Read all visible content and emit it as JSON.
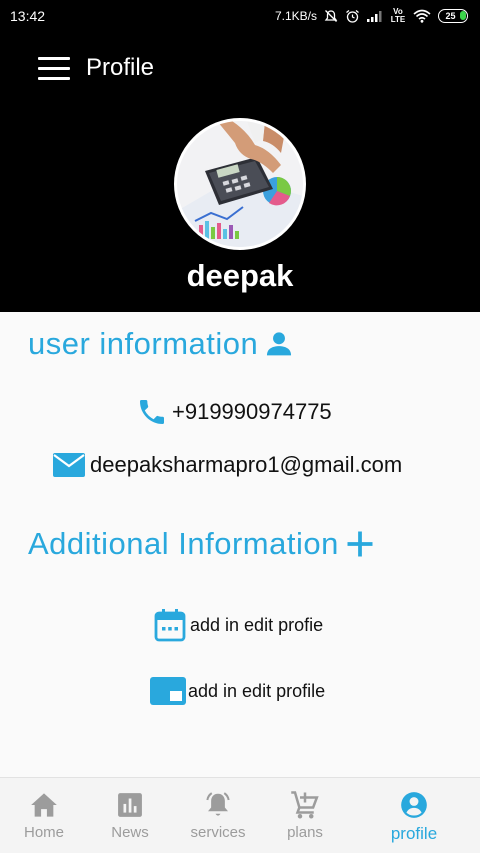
{
  "status_bar": {
    "time": "13:42",
    "speed": "7.1KB/s",
    "network": "Vo LTE",
    "battery": "25"
  },
  "header": {
    "title": "Profile",
    "username": "deepak"
  },
  "user_info": {
    "title": "user information",
    "phone": "+919990974775",
    "email": "deepaksharmapro1@gmail.com"
  },
  "additional_info": {
    "title": "Additional Information",
    "item1": "add in edit profie",
    "item2": "add in edit profile"
  },
  "bottom_nav": [
    {
      "label": "Home",
      "icon": "home-icon",
      "active": false
    },
    {
      "label": "News",
      "icon": "chart-icon",
      "active": false
    },
    {
      "label": "services",
      "icon": "bell-icon",
      "active": false
    },
    {
      "label": "plans",
      "icon": "cart-plus-icon",
      "active": false
    },
    {
      "label": "profile",
      "icon": "account-circle-icon",
      "active": true
    }
  ],
  "colors": {
    "accent": "#29a8dd",
    "header_bg": "#000000",
    "inactive": "#9c9c9c"
  }
}
